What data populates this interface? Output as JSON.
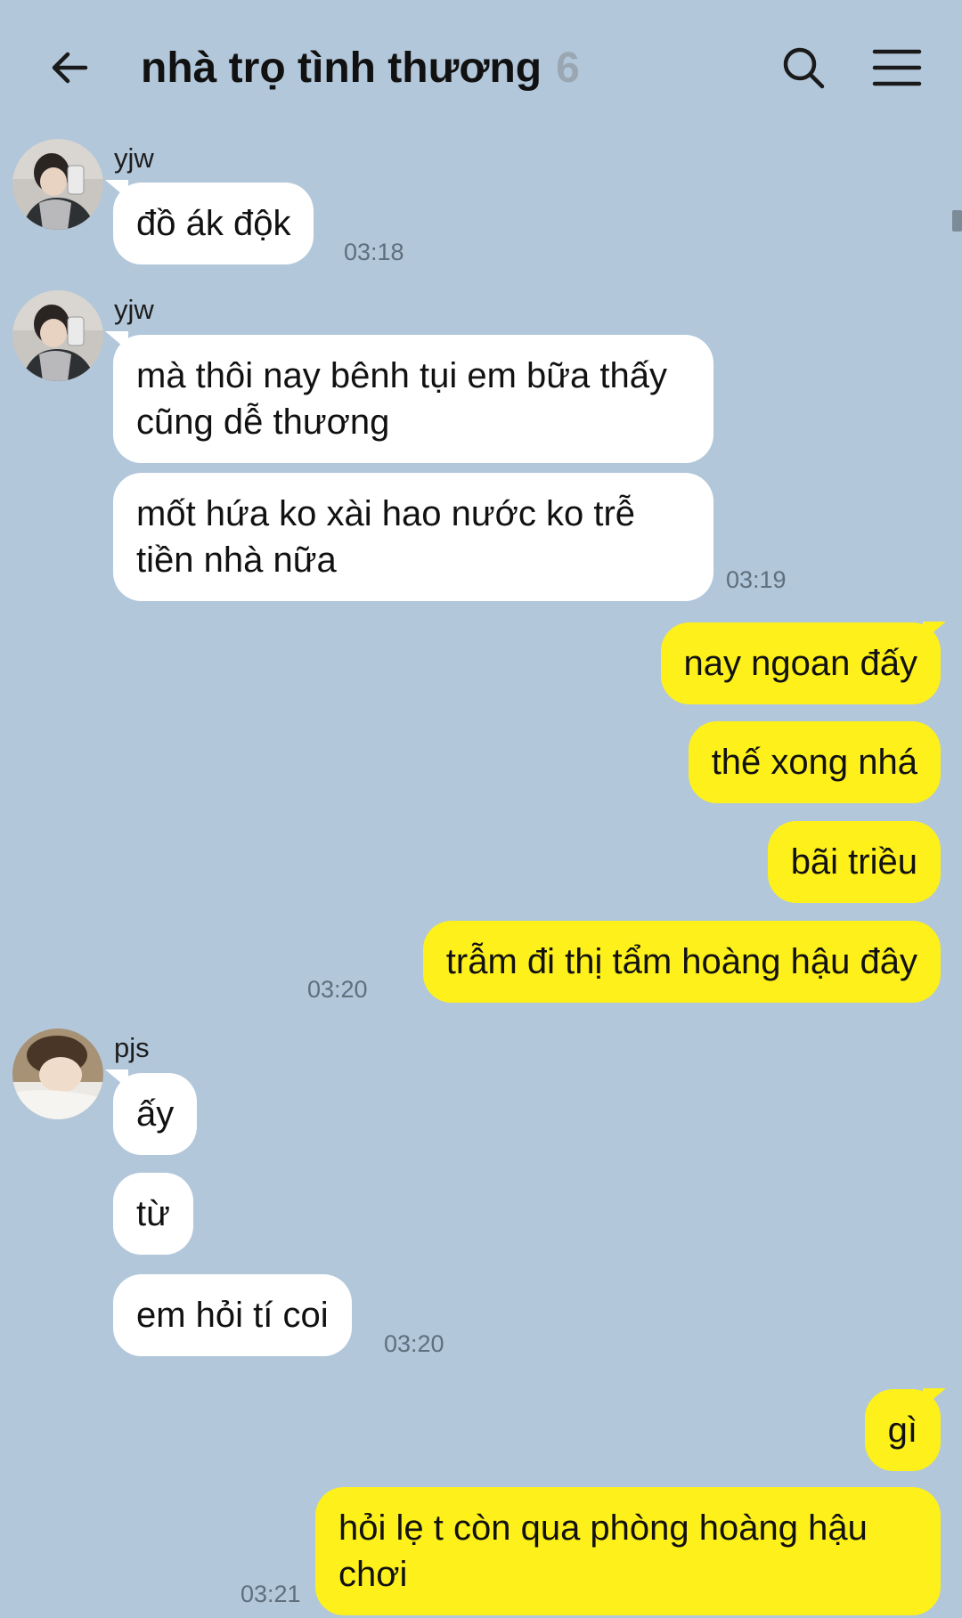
{
  "header": {
    "title": "nhà trọ tình thương",
    "member_count": "6",
    "back_icon": "arrow-left-icon",
    "search_icon": "search-icon",
    "menu_icon": "hamburger-menu-icon"
  },
  "colors": {
    "background": "#b2c7da",
    "incoming_bubble": "#ffffff",
    "outgoing_bubble": "#fef01b",
    "timestamp": "#5f6f7d"
  },
  "messages": {
    "g1": {
      "sender": "yjw",
      "m1": "đồ ák độk",
      "time": "03:18"
    },
    "g2": {
      "sender": "yjw",
      "m1": "mà thôi nay bênh tụi em bữa thấy cũng dễ thương",
      "m2": "mốt hứa ko xài hao nước ko trễ tiền nhà nữa",
      "time": "03:19"
    },
    "g3": {
      "m1": "nay ngoan đấy",
      "m2": "thế xong nhá",
      "m3": "bãi triều",
      "m4": "trẫm đi thị tẩm hoàng hậu đây",
      "time": "03:20"
    },
    "g4": {
      "sender": "pjs",
      "m1": "ấy",
      "m2": "từ",
      "m3": "em hỏi tí coi",
      "time": "03:20"
    },
    "g5": {
      "m1": "gì",
      "m2": "hỏi lẹ t còn qua phòng hoàng hậu chơi",
      "time": "03:21"
    }
  }
}
